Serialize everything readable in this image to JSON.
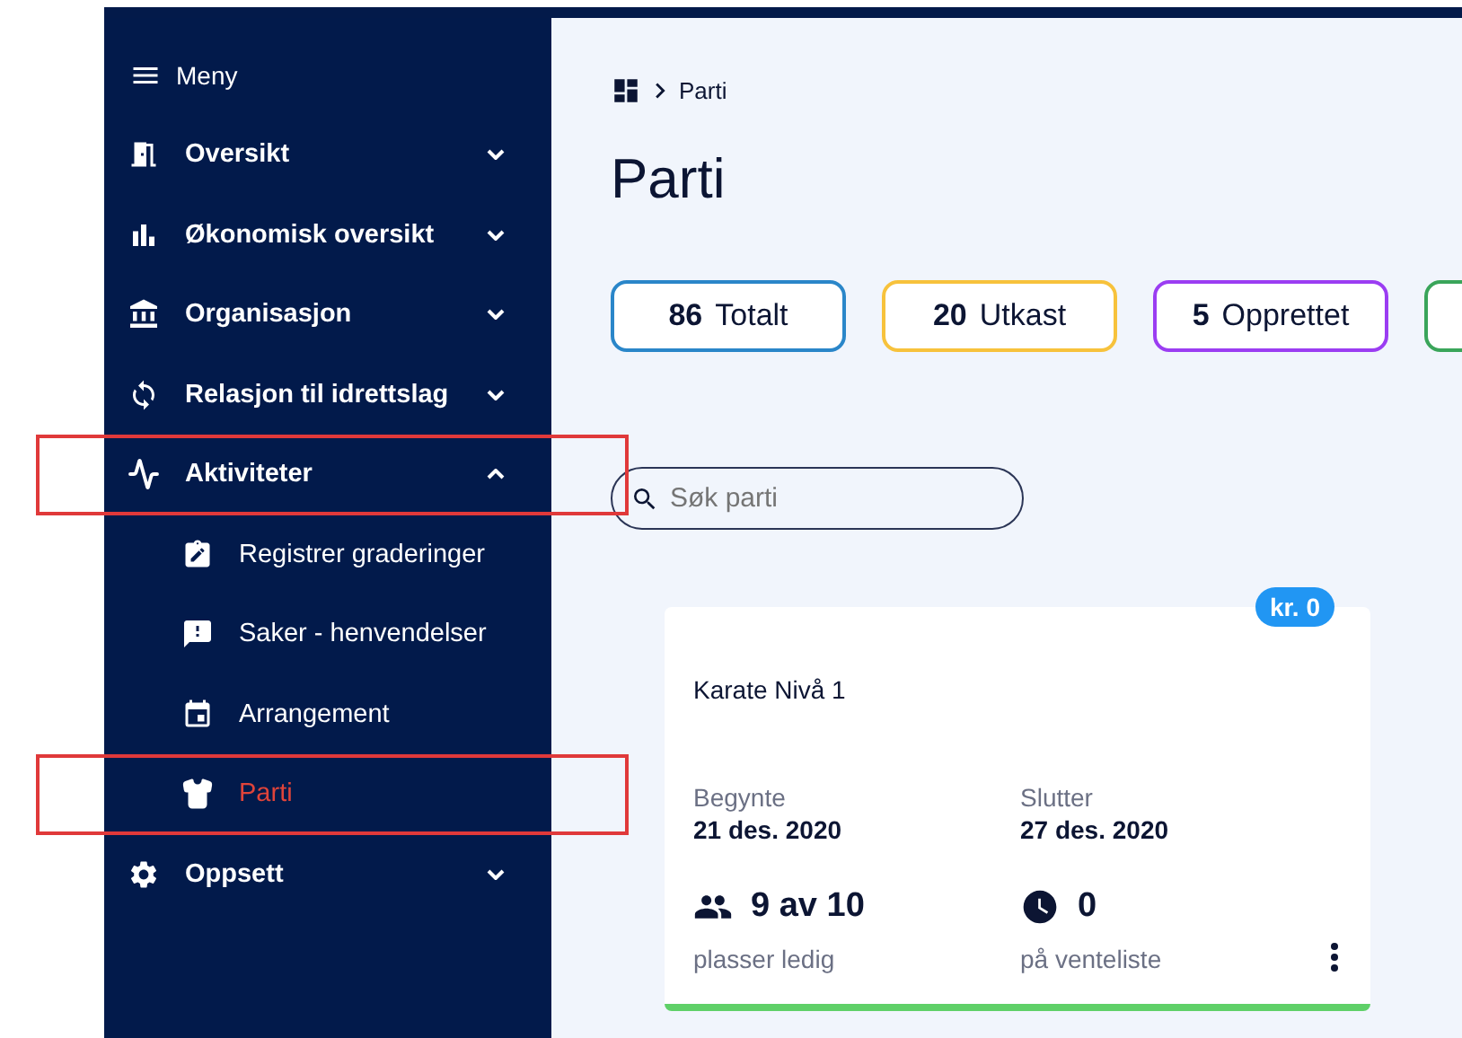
{
  "sidebar": {
    "menu_label": "Meny",
    "items": [
      {
        "label": "Oversikt",
        "expanded": false,
        "highlighted": false
      },
      {
        "label": "Økonomisk oversikt",
        "expanded": false,
        "highlighted": false
      },
      {
        "label": "Organisasjon",
        "expanded": false,
        "highlighted": false
      },
      {
        "label": "Relasjon til idrettslag",
        "expanded": false,
        "highlighted": false
      },
      {
        "label": "Aktiviteter",
        "expanded": true,
        "highlighted": true,
        "children": [
          {
            "label": "Registrer graderinger",
            "selected": false,
            "highlighted": false
          },
          {
            "label": "Saker - henvendelser",
            "selected": false,
            "highlighted": false
          },
          {
            "label": "Arrangement",
            "selected": false,
            "highlighted": false
          },
          {
            "label": "Parti",
            "selected": true,
            "highlighted": true
          }
        ]
      },
      {
        "label": "Oppsett",
        "expanded": false,
        "highlighted": false
      }
    ]
  },
  "breadcrumb": [
    "Parti"
  ],
  "title": "Parti",
  "stats": [
    {
      "count": "86",
      "label": "Totalt",
      "color": "#2a86c9"
    },
    {
      "count": "20",
      "label": "Utkast",
      "color": "#f7c23c"
    },
    {
      "count": "5",
      "label": "Opprettet",
      "color": "#9b3df2"
    },
    {
      "color": "#3aa55a"
    }
  ],
  "search": {
    "placeholder": "Søk parti"
  },
  "cards": [
    {
      "price": "kr. 0",
      "title": "Karate Nivå 1",
      "start_label": "Begynte",
      "start": "21 des. 2020",
      "end_label": "Slutter",
      "end": "27 des. 2020",
      "places": "9 av 10",
      "places_label": "plasser ledig",
      "waitlist": "0",
      "waitlist_label": "på venteliste",
      "color": "#5fd068"
    }
  ]
}
